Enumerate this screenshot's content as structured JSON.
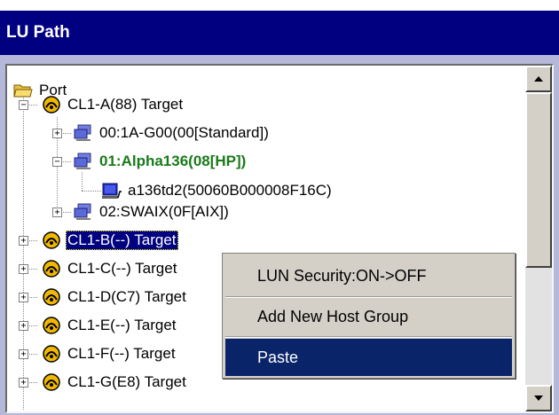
{
  "window": {
    "title": "LU Path"
  },
  "tree": {
    "root": {
      "label": "Port",
      "icon": "folder-icon"
    },
    "ports": [
      {
        "label": "CL1-A(88) Target",
        "icon": "port-target-icon",
        "expanded": true
      },
      {
        "label": "CL1-B(--) Target",
        "icon": "port-target-icon",
        "expanded": false,
        "selected": true
      },
      {
        "label": "CL1-C(--) Target",
        "icon": "port-target-icon",
        "expanded": false
      },
      {
        "label": "CL1-D(C7) Target",
        "icon": "port-target-icon",
        "expanded": false
      },
      {
        "label": "CL1-E(--) Target",
        "icon": "port-target-icon",
        "expanded": false
      },
      {
        "label": "CL1-F(--) Target",
        "icon": "port-target-icon",
        "expanded": false
      },
      {
        "label": "CL1-G(E8) Target",
        "icon": "port-target-icon",
        "expanded": false
      }
    ],
    "host_groups": [
      {
        "label": "00:1A-G00(00[Standard])",
        "icon": "host-group-icon",
        "expanded": false
      },
      {
        "label": "01:Alpha136(08[HP])",
        "icon": "host-group-icon",
        "expanded": true,
        "highlight_color": "#1a7a1a"
      },
      {
        "label": "02:SWAIX(0F[AIX])",
        "icon": "host-group-icon",
        "expanded": false
      }
    ],
    "wwn": {
      "label": "a136td2(50060B000008F16C)",
      "icon": "wwn-host-icon"
    }
  },
  "context_menu": {
    "items": [
      {
        "label": "LUN Security:ON->OFF"
      },
      {
        "label": "Add New Host Group"
      },
      {
        "label": "Paste",
        "highlighted": true
      }
    ]
  },
  "colors": {
    "title_bg": "#000080",
    "frame_bg": "#b5b8d8",
    "selection": "#000080",
    "menu_highlight": "#0a246a"
  }
}
